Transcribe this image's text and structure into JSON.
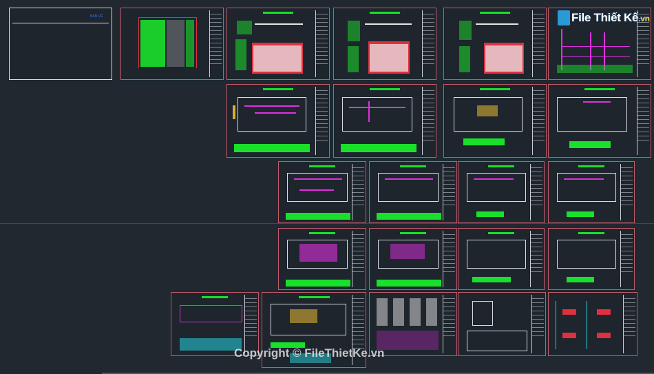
{
  "watermark": {
    "logo_text": "File Thiết Kế",
    "logo_suffix": ".vn",
    "copyright": "Copyright © FileThietKe.vn"
  },
  "cover_sheet": {
    "label": "BẢN VẼ"
  },
  "colors": {
    "background": "#212830",
    "sheet_border": "#c25a6a",
    "title_green": "#19e02a",
    "wiring_magenta": "#e030e0",
    "logo_blue": "#2a9ad6"
  }
}
